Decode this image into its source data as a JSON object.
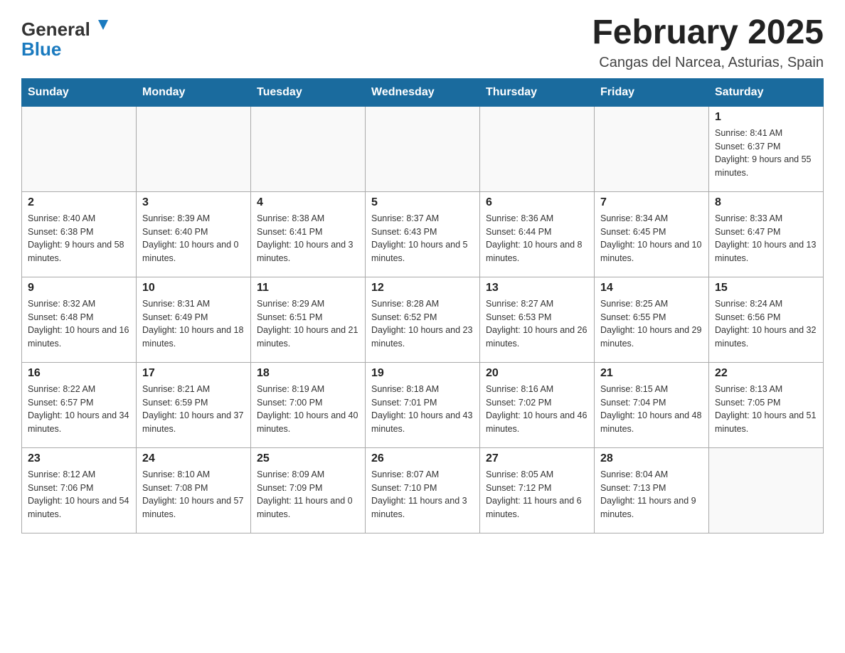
{
  "header": {
    "logo_text_general": "General",
    "logo_text_blue": "Blue",
    "title": "February 2025",
    "subtitle": "Cangas del Narcea, Asturias, Spain"
  },
  "days_of_week": [
    "Sunday",
    "Monday",
    "Tuesday",
    "Wednesday",
    "Thursday",
    "Friday",
    "Saturday"
  ],
  "weeks": [
    [
      {
        "day": "",
        "info": ""
      },
      {
        "day": "",
        "info": ""
      },
      {
        "day": "",
        "info": ""
      },
      {
        "day": "",
        "info": ""
      },
      {
        "day": "",
        "info": ""
      },
      {
        "day": "",
        "info": ""
      },
      {
        "day": "1",
        "info": "Sunrise: 8:41 AM\nSunset: 6:37 PM\nDaylight: 9 hours and 55 minutes."
      }
    ],
    [
      {
        "day": "2",
        "info": "Sunrise: 8:40 AM\nSunset: 6:38 PM\nDaylight: 9 hours and 58 minutes."
      },
      {
        "day": "3",
        "info": "Sunrise: 8:39 AM\nSunset: 6:40 PM\nDaylight: 10 hours and 0 minutes."
      },
      {
        "day": "4",
        "info": "Sunrise: 8:38 AM\nSunset: 6:41 PM\nDaylight: 10 hours and 3 minutes."
      },
      {
        "day": "5",
        "info": "Sunrise: 8:37 AM\nSunset: 6:43 PM\nDaylight: 10 hours and 5 minutes."
      },
      {
        "day": "6",
        "info": "Sunrise: 8:36 AM\nSunset: 6:44 PM\nDaylight: 10 hours and 8 minutes."
      },
      {
        "day": "7",
        "info": "Sunrise: 8:34 AM\nSunset: 6:45 PM\nDaylight: 10 hours and 10 minutes."
      },
      {
        "day": "8",
        "info": "Sunrise: 8:33 AM\nSunset: 6:47 PM\nDaylight: 10 hours and 13 minutes."
      }
    ],
    [
      {
        "day": "9",
        "info": "Sunrise: 8:32 AM\nSunset: 6:48 PM\nDaylight: 10 hours and 16 minutes."
      },
      {
        "day": "10",
        "info": "Sunrise: 8:31 AM\nSunset: 6:49 PM\nDaylight: 10 hours and 18 minutes."
      },
      {
        "day": "11",
        "info": "Sunrise: 8:29 AM\nSunset: 6:51 PM\nDaylight: 10 hours and 21 minutes."
      },
      {
        "day": "12",
        "info": "Sunrise: 8:28 AM\nSunset: 6:52 PM\nDaylight: 10 hours and 23 minutes."
      },
      {
        "day": "13",
        "info": "Sunrise: 8:27 AM\nSunset: 6:53 PM\nDaylight: 10 hours and 26 minutes."
      },
      {
        "day": "14",
        "info": "Sunrise: 8:25 AM\nSunset: 6:55 PM\nDaylight: 10 hours and 29 minutes."
      },
      {
        "day": "15",
        "info": "Sunrise: 8:24 AM\nSunset: 6:56 PM\nDaylight: 10 hours and 32 minutes."
      }
    ],
    [
      {
        "day": "16",
        "info": "Sunrise: 8:22 AM\nSunset: 6:57 PM\nDaylight: 10 hours and 34 minutes."
      },
      {
        "day": "17",
        "info": "Sunrise: 8:21 AM\nSunset: 6:59 PM\nDaylight: 10 hours and 37 minutes."
      },
      {
        "day": "18",
        "info": "Sunrise: 8:19 AM\nSunset: 7:00 PM\nDaylight: 10 hours and 40 minutes."
      },
      {
        "day": "19",
        "info": "Sunrise: 8:18 AM\nSunset: 7:01 PM\nDaylight: 10 hours and 43 minutes."
      },
      {
        "day": "20",
        "info": "Sunrise: 8:16 AM\nSunset: 7:02 PM\nDaylight: 10 hours and 46 minutes."
      },
      {
        "day": "21",
        "info": "Sunrise: 8:15 AM\nSunset: 7:04 PM\nDaylight: 10 hours and 48 minutes."
      },
      {
        "day": "22",
        "info": "Sunrise: 8:13 AM\nSunset: 7:05 PM\nDaylight: 10 hours and 51 minutes."
      }
    ],
    [
      {
        "day": "23",
        "info": "Sunrise: 8:12 AM\nSunset: 7:06 PM\nDaylight: 10 hours and 54 minutes."
      },
      {
        "day": "24",
        "info": "Sunrise: 8:10 AM\nSunset: 7:08 PM\nDaylight: 10 hours and 57 minutes."
      },
      {
        "day": "25",
        "info": "Sunrise: 8:09 AM\nSunset: 7:09 PM\nDaylight: 11 hours and 0 minutes."
      },
      {
        "day": "26",
        "info": "Sunrise: 8:07 AM\nSunset: 7:10 PM\nDaylight: 11 hours and 3 minutes."
      },
      {
        "day": "27",
        "info": "Sunrise: 8:05 AM\nSunset: 7:12 PM\nDaylight: 11 hours and 6 minutes."
      },
      {
        "day": "28",
        "info": "Sunrise: 8:04 AM\nSunset: 7:13 PM\nDaylight: 11 hours and 9 minutes."
      },
      {
        "day": "",
        "info": ""
      }
    ]
  ]
}
